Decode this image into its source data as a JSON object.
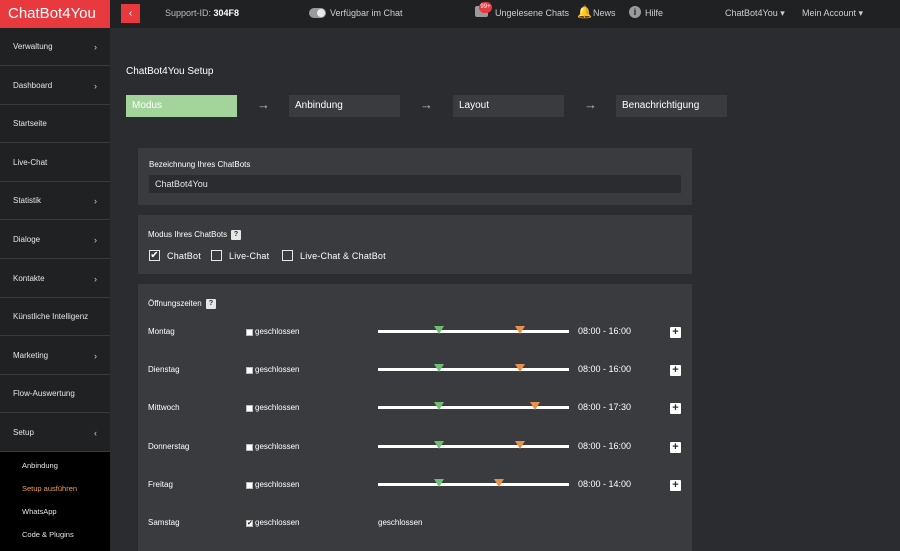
{
  "header": {
    "logo": "ChatBot4You",
    "collapse_icon": "‹",
    "support_label": "Support-ID: ",
    "support_id": "304F8",
    "available_label": "Verfügbar im Chat",
    "badge": "99+",
    "unread_label": "Ungelesene Chats",
    "news_label": "News",
    "help_label": "Hilfe",
    "account1": "ChatBot4You ▾",
    "account2": "Mein Account ▾",
    "info_glyph": "i",
    "bell_glyph": "🔔"
  },
  "sidebar": {
    "items": [
      {
        "label": "Verwaltung",
        "chev": "›"
      },
      {
        "label": "Dashboard",
        "chev": "›"
      },
      {
        "label": "Startseite",
        "chev": ""
      },
      {
        "label": "Live-Chat",
        "chev": ""
      },
      {
        "label": "Statistik",
        "chev": "›"
      },
      {
        "label": "Dialoge",
        "chev": "›"
      },
      {
        "label": "Kontakte",
        "chev": "›"
      },
      {
        "label": "Künstliche Intelligenz",
        "chev": ""
      },
      {
        "label": "Marketing",
        "chev": "›"
      },
      {
        "label": "Flow-Auswertung",
        "chev": ""
      },
      {
        "label": "Setup",
        "chev": "‹"
      }
    ],
    "submenu": [
      {
        "label": "Anbindung"
      },
      {
        "label": "Setup ausführen"
      },
      {
        "label": "WhatsApp"
      },
      {
        "label": "Code & Plugins"
      }
    ]
  },
  "main": {
    "title": "ChatBot4You Setup",
    "steps": [
      "Modus",
      "Anbindung",
      "Layout",
      "Benachrichtigung"
    ],
    "arrow": "→",
    "name_label": "Bezeichnung Ihres ChatBots",
    "name_value": "ChatBot4You",
    "mode_label": "Modus Ihres ChatBots",
    "help_glyph": "?",
    "modes": [
      {
        "label": "ChatBot",
        "checked": "✔"
      },
      {
        "label": "Live-Chat",
        "checked": ""
      },
      {
        "label": "Live-Chat & ChatBot",
        "checked": ""
      }
    ],
    "hours_label": "Öffnungszeiten",
    "closed_label": "geschlossen",
    "plus_glyph": "+",
    "days": [
      {
        "day": "Montag",
        "time": "08:00 - 16:00",
        "closed": false,
        "cb": "",
        "start": 8,
        "end": 16
      },
      {
        "day": "Dienstag",
        "time": "08:00 - 16:00",
        "closed": false,
        "cb": "",
        "start": 8,
        "end": 16
      },
      {
        "day": "Mittwoch",
        "time": "08:00 - 17:30",
        "closed": false,
        "cb": "",
        "start": 8,
        "end": 17.5
      },
      {
        "day": "Donnerstag",
        "time": "08:00 - 16:00",
        "closed": false,
        "cb": "",
        "start": 8,
        "end": 16
      },
      {
        "day": "Freitag",
        "time": "08:00 - 14:00",
        "closed": false,
        "cb": "",
        "start": 8,
        "end": 14
      },
      {
        "day": "Samstag",
        "time": "",
        "closed": true,
        "cb": "✔",
        "closed_text": "geschlossen"
      }
    ]
  }
}
